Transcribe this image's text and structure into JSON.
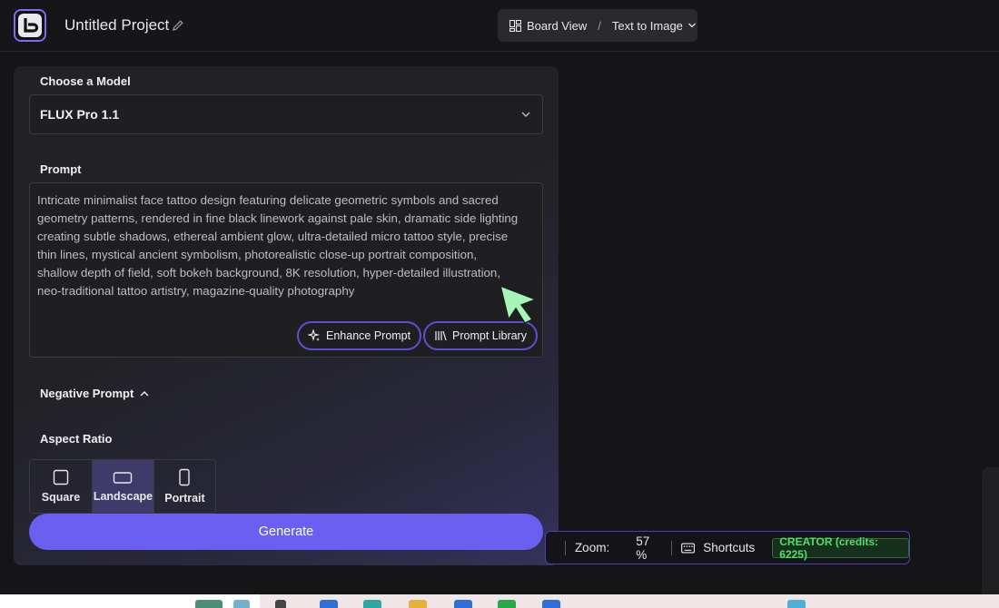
{
  "header": {
    "project_title": "Untitled Project",
    "view_name": "Board View",
    "breadcrumb_sep": "/",
    "mode_name": "Text to Image"
  },
  "panel": {
    "model_label": "Choose a Model",
    "model_value": "FLUX Pro 1.1",
    "prompt_label": "Prompt",
    "prompt_text": "Intricate minimalist face tattoo design featuring delicate geometric symbols and sacred geometry patterns, rendered in fine black linework against pale skin, dramatic side lighting creating subtle shadows, ethereal ambient glow, ultra-detailed micro tattoo style, precise thin lines, mystical ancient symbolism, photorealistic close-up portrait composition, shallow depth of field, soft bokeh background, 8K resolution, hyper-detailed illustration, neo-traditional tattoo artistry, magazine-quality photography",
    "enhance_label": "Enhance Prompt",
    "library_label": "Prompt Library",
    "negative_label": "Negative Prompt",
    "aspect_label": "Aspect Ratio",
    "ratios": [
      {
        "label": "Square",
        "selected": false
      },
      {
        "label": "Landscape",
        "selected": true
      },
      {
        "label": "Portrait",
        "selected": false
      }
    ],
    "generate_label": "Generate"
  },
  "status": {
    "zoom_label": "Zoom:",
    "zoom_value": "57 %",
    "shortcuts_label": "Shortcuts",
    "credits_badge": "CREATOR (credits: 6225)"
  },
  "colors": {
    "accent": "#6a5ff0",
    "credits_green": "#4ee06b",
    "cursor": "#a6f5b8"
  }
}
